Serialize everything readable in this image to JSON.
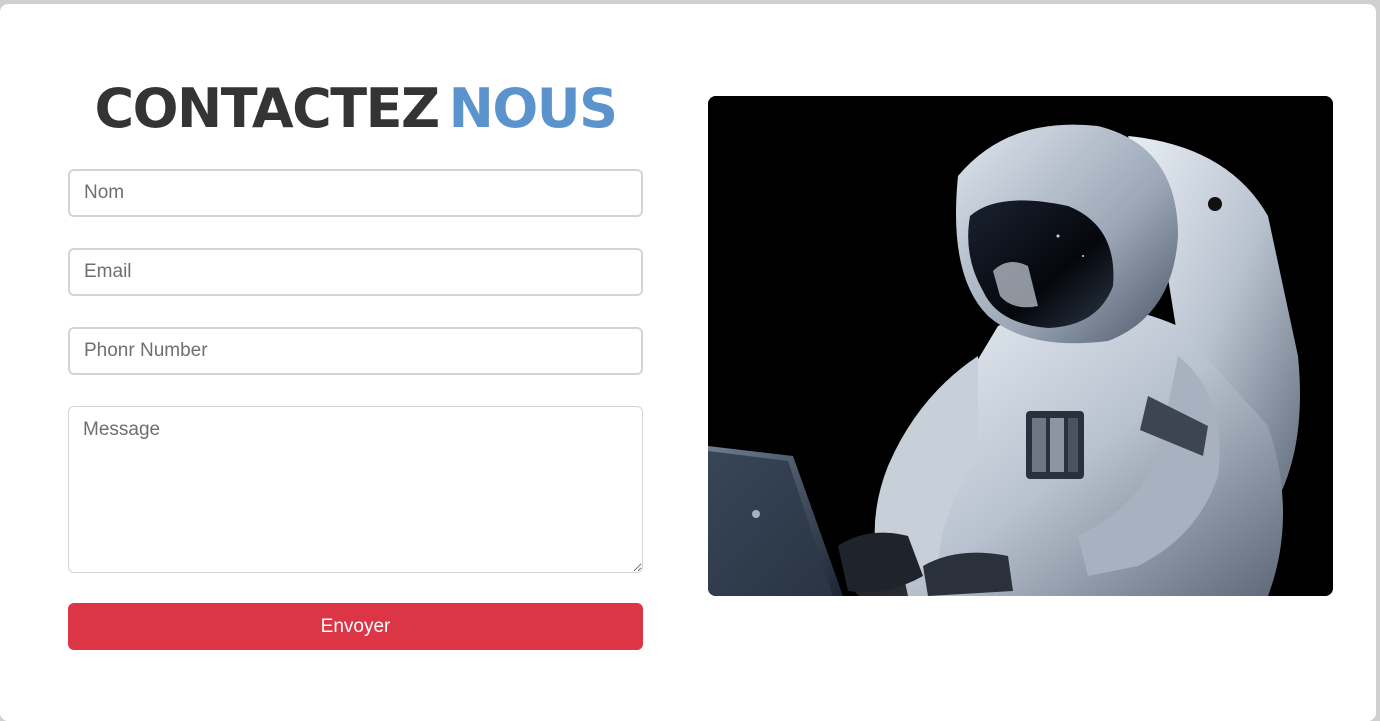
{
  "heading": {
    "part1": "CONTACTEZ",
    "part2": "NOUS"
  },
  "form": {
    "name_placeholder": "Nom",
    "email_placeholder": "Email",
    "phone_placeholder": "Phonr Number",
    "message_placeholder": "Message",
    "submit_label": "Envoyer"
  },
  "image": {
    "subject": "astronaut-using-laptop"
  },
  "colors": {
    "heading_dark": "#343434",
    "heading_accent": "#5b93cd",
    "submit_bg": "#dc3545"
  }
}
